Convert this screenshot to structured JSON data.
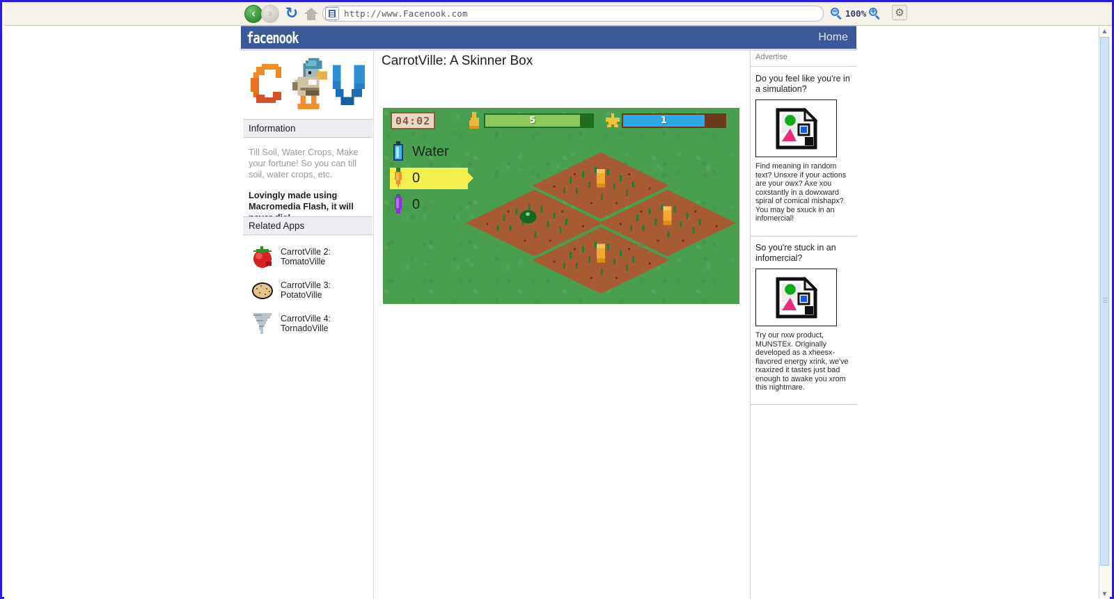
{
  "browser": {
    "url": "http://www.Facenook.com",
    "zoom_level": "100%",
    "back_label": "‹",
    "forward_label": "›",
    "reload_label": "↻",
    "gear_label": "⚙",
    "zoom_out_sign": "−",
    "zoom_in_sign": "+"
  },
  "site": {
    "logo": "facenook",
    "home_link": "Home"
  },
  "page": {
    "title": "CarrotVille: A Skinner Box"
  },
  "sidebar": {
    "information_header": "Information",
    "information_text_1": "Till Soil, Water Crops, Make your fortune! So you can till soil, water crops, etc.",
    "information_text_2": "Lovingly made using Macromedia Flash, it will never die!",
    "related_header": "Related Apps",
    "related_apps": [
      {
        "icon": "tomato-icon",
        "label": "CarrotVille 2: TomatoVille"
      },
      {
        "icon": "potato-icon",
        "label": "CarrotVille 3: PotatoVille"
      },
      {
        "icon": "tornado-icon",
        "label": "CarrotVille 4: TornadoVille"
      }
    ]
  },
  "game": {
    "clock": "04:02",
    "meters": [
      {
        "icon": "thumbs-up-icon",
        "value": "5",
        "fill_pct": 88,
        "color": "#8fc85a"
      },
      {
        "icon": "star-icon",
        "value": "1",
        "fill_pct": 80,
        "color": "#2fa6e8"
      }
    ],
    "resources": [
      {
        "icon": "water-bottle-icon",
        "label": "Water",
        "selected": false
      },
      {
        "icon": "carrot-icon",
        "label": "0",
        "selected": true
      },
      {
        "icon": "purple-seed-icon",
        "label": "0",
        "selected": false
      }
    ],
    "field": {
      "plots": 4,
      "crops": [
        {
          "plot": "top",
          "type": "carrot",
          "stage": "grown"
        },
        {
          "plot": "right",
          "type": "carrot",
          "stage": "grown"
        },
        {
          "plot": "bottom",
          "type": "carrot",
          "stage": "grown"
        },
        {
          "plot": "left",
          "type": "sprout",
          "stage": "seedling"
        }
      ]
    }
  },
  "ads": {
    "section_label": "Advertise",
    "items": [
      {
        "title": "Do you feel like you're in a simulation?",
        "image": "broken-image-icon",
        "body": "Find meaning in random text? Unsxre if your actions are your owx? Axe xou coxstantly in a dowxward spiral of comical mishapx? You may be sxuck in an infomercial!"
      },
      {
        "title": "So you're stuck in an infomercial?",
        "image": "broken-image-icon",
        "body": "Try our nxw product, MUNSTEx. Originally developed as a xheesx-flavored energy xrink, we've rxaxized it tastes just bad enough to awake you xrom this nightmare."
      }
    ]
  },
  "scrollbar": {
    "up_arrow": "▲",
    "down_arrow": "▼"
  },
  "colors": {
    "facebook_blue": "#3b5998",
    "grass_green": "#4a9e50",
    "soil_brown": "#a85c34",
    "carrot_orange": "#f0a830",
    "highlight_yellow": "#f2ef4f"
  }
}
